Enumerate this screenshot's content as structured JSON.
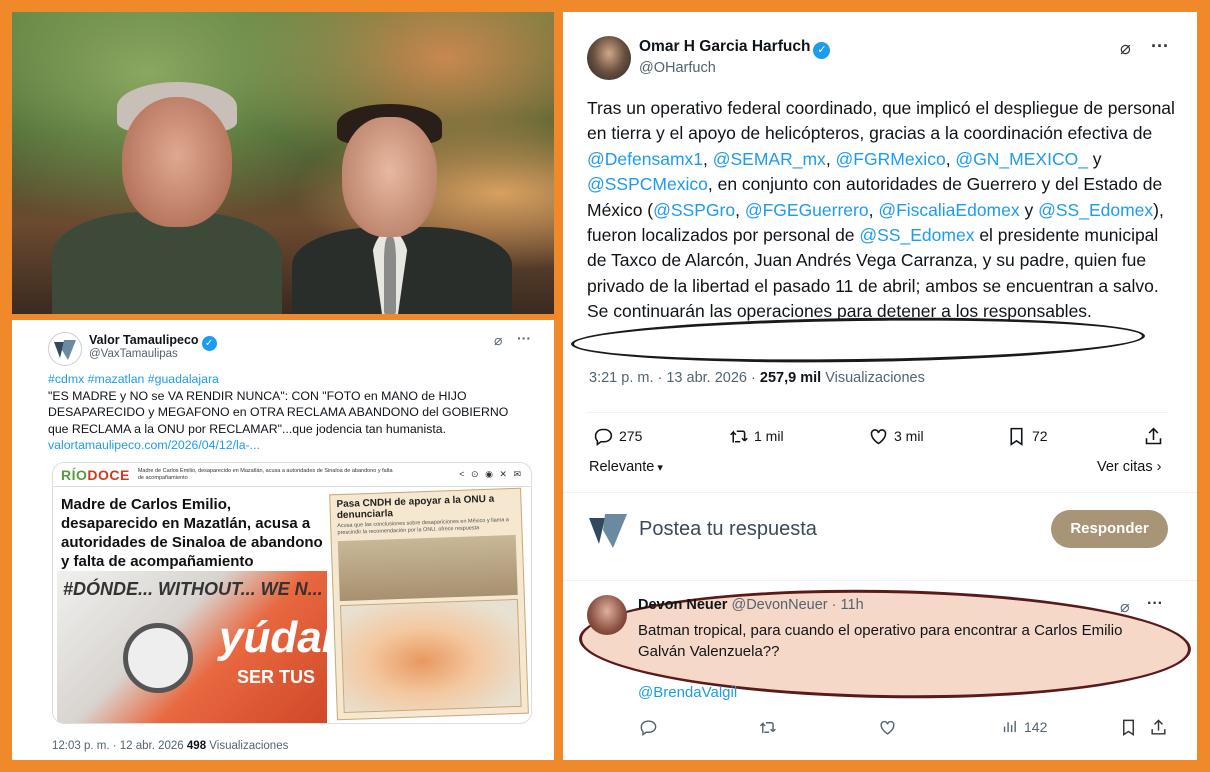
{
  "left_tweet": {
    "name": "Valor Tamaulipeco",
    "handle": "@VaxTamaulipas",
    "hashtags": "#cdmx #mazatlan #guadalajara",
    "text": "\"ES MADRE y NO se VA RENDIR NUNCA\": CON \"FOTO en MANO de HIJO DESAPARECIDO y MEGAFONO en OTRA RECLAMA ABANDONO del GOBIERNO que RECLAMA a la ONU por RECLAMAR\"...que jodencia tan humanista.",
    "link": "valortamaulipeco.com/2026/04/12/la-...",
    "card": {
      "brand_left": "RÍO",
      "brand_right": "DOCE",
      "header_caption": "Madre de Carlos Emilio, desaparecido en Mazatlán, acusa a autoridades de Sinaloa de abandono y falta de acompañamiento",
      "headline": "Madre de Carlos Emilio, desaparecido en Mazatlán, acusa a autoridades de Sinaloa de abandono y falta de acompañamiento",
      "photo_sign": "#DÓNDE... WITHOUT... WE N...",
      "photo_big": "yúdar",
      "photo_small": "SER TUS",
      "inset_title": "Pasa CNDH de apoyar a la ONU a denunciarla",
      "inset_sub": "Acusa que las conclusiones sobre desapariciones en México y llama a prescindir la recomendación por la ONU, ofrece respuesta"
    },
    "timestamp": "12:03 p. m. · 12 abr. 2026",
    "views_count": "498",
    "views_label": "Visualizaciones"
  },
  "right_tweet": {
    "name": "Omar H Garcia Harfuch",
    "handle": "@OHarfuch",
    "body": {
      "p1": "Tras un operativo federal coordinado, que implicó el despliegue de personal en tierra y el apoyo de helicópteros,  gracias a la coordinación efectiva de ",
      "m1": "@Defensamx1",
      "s1": ", ",
      "m2": "@SEMAR_mx",
      "s2": ", ",
      "m3": "@FGRMexico",
      "s3": ", ",
      "m4": "@GN_MEXICO_",
      "s4": " y ",
      "m5": "@SSPCMexico",
      "s5": ", en conjunto con autoridades de Guerrero y del Estado de México (",
      "m6": "@SSPGro",
      "s6": ", ",
      "m7": "@FGEGuerrero",
      "s7": ", ",
      "m8": "@FiscaliaEdomex",
      "s8": " y ",
      "m9": "@SS_Edomex",
      "s9": "), fueron localizados por  personal de ",
      "m10": "@SS_Edomex",
      "s10": " el presidente municipal de Taxco de Alarcón, Juan Andrés Vega Carranza, y su padre, quien fue privado de la libertad el pasado 11 de abril; ambos se encuentran a salvo.",
      "last": "Se continuarán las operaciones para detener a los responsables."
    },
    "timestamp": "3:21 p. m. · 13 abr. 2026 · ",
    "views_count": "257,9 mil",
    "views_label": "Visualizaciones",
    "stats": {
      "replies": "275",
      "reposts": "1 mil",
      "likes": "3 mil",
      "bookmarks": "72"
    },
    "relevance": "Relevante",
    "see_quotes": "Ver citas",
    "compose_placeholder": "Postea tu respuesta",
    "reply_button": "Responder",
    "reply": {
      "name": "Devon Neuer",
      "handle": "@DevonNeuer",
      "time": "· 11h",
      "text": "Batman tropical, para cuando el operativo para encontrar a Carlos Emilio Galván Valenzuela??",
      "mention": "@BrendaValgil",
      "views": "142"
    }
  },
  "colors": {
    "frame": "#f0892a",
    "link": "#1d9bf0",
    "verified": "#1d9bf0",
    "reply_button": "#a89578",
    "highlight_oval": "#1a1a1a",
    "reply_oval": "#5a1a1a",
    "reply_fill": "#f6d8c8"
  }
}
